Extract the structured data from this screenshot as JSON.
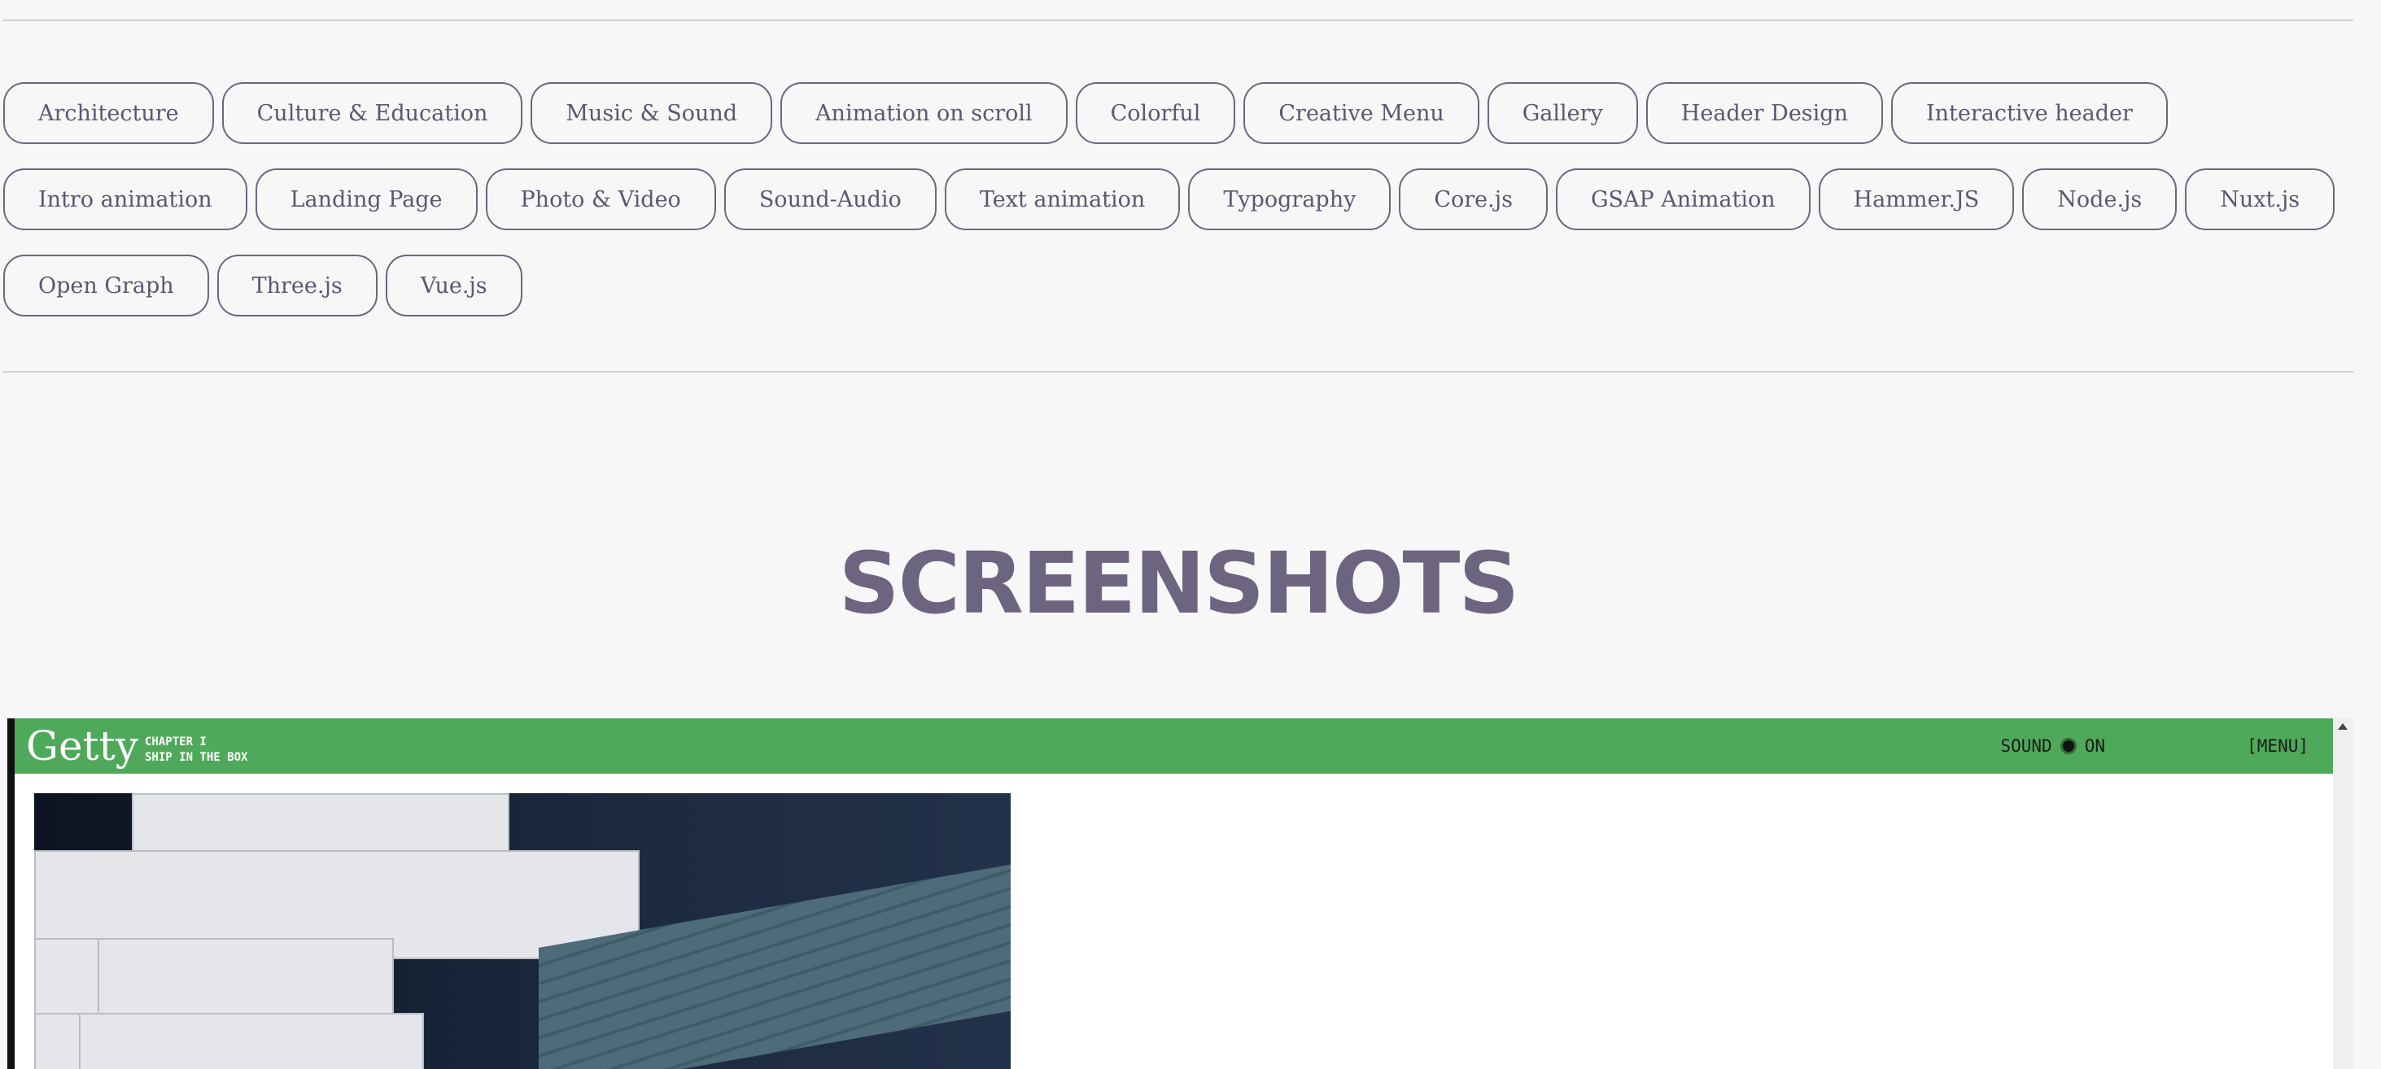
{
  "tags": [
    "Architecture",
    "Culture & Education",
    "Music & Sound",
    "Animation on scroll",
    "Colorful",
    "Creative Menu",
    "Gallery",
    "Header Design",
    "Interactive header",
    "Intro animation",
    "Landing Page",
    "Photo & Video",
    "Sound-Audio",
    "Text animation",
    "Typography",
    "Core.js",
    "GSAP Animation",
    "Hammer.JS",
    "Node.js",
    "Nuxt.js",
    "Open Graph",
    "Three.js",
    "Vue.js"
  ],
  "heading": "SCREENSHOTS",
  "screenshot": {
    "brand": "Getty",
    "chapter_line1": "CHAPTER I",
    "chapter_line2": "SHIP IN THE BOX",
    "sound_label": "SOUND",
    "sound_state": "ON",
    "menu_label": "[MENU]"
  },
  "colors": {
    "accent": "#6d6480",
    "tag_border": "#6e6680",
    "screenshot_bar": "#4fa95a",
    "background": "#f7f7f7"
  }
}
